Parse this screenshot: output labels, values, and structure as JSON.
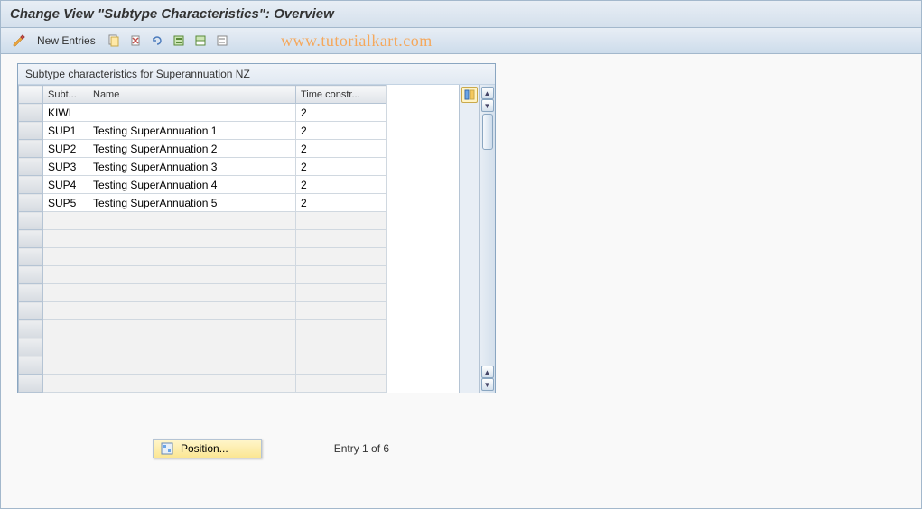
{
  "title": "Change View \"Subtype Characteristics\": Overview",
  "toolbar": {
    "new_entries_label": "New Entries"
  },
  "watermark": "www.tutorialkart.com",
  "panel": {
    "title": "Subtype characteristics for Superannuation NZ"
  },
  "columns": {
    "subt": "Subt...",
    "name": "Name",
    "tc": "Time constr..."
  },
  "rows": [
    {
      "subt": "KIWI",
      "name": "",
      "tc": "2"
    },
    {
      "subt": "SUP1",
      "name": "Testing SuperAnnuation 1",
      "tc": "2"
    },
    {
      "subt": "SUP2",
      "name": "Testing SuperAnnuation 2",
      "tc": "2"
    },
    {
      "subt": "SUP3",
      "name": "Testing SuperAnnuation 3",
      "tc": "2"
    },
    {
      "subt": "SUP4",
      "name": "Testing SuperAnnuation 4",
      "tc": "2"
    },
    {
      "subt": "SUP5",
      "name": "Testing SuperAnnuation 5",
      "tc": "2"
    }
  ],
  "empty_row_count": 10,
  "footer": {
    "position_label": "Position...",
    "entry_text": "Entry 1 of 6"
  }
}
